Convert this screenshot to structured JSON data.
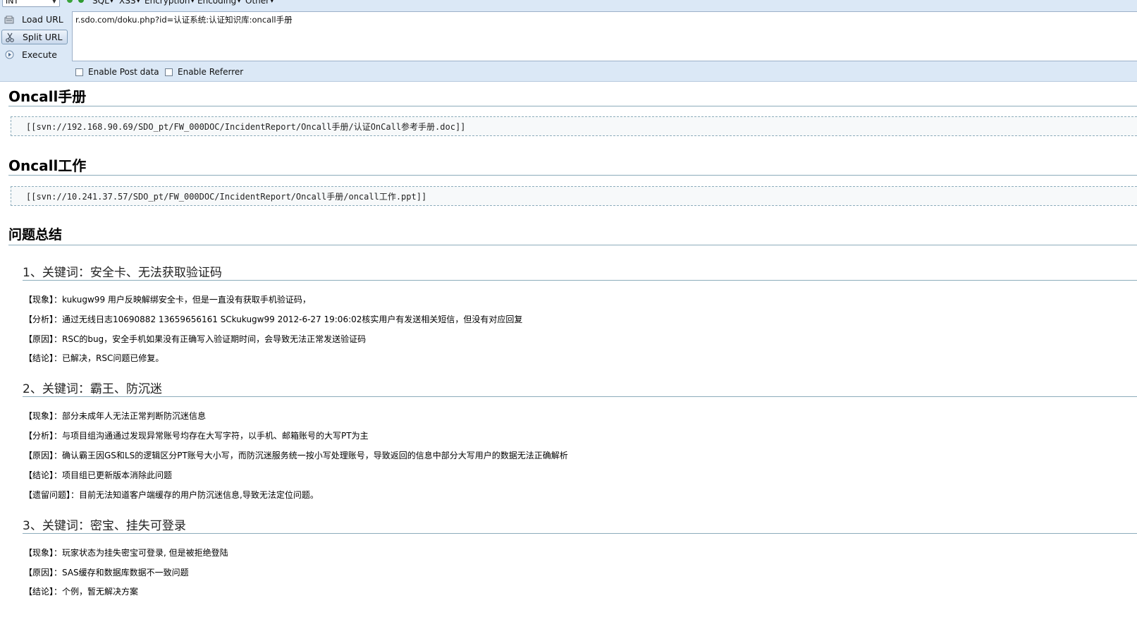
{
  "toolbar": {
    "select_value": "INT",
    "menus": [
      "SQL",
      "XSS",
      "Encryption",
      "Encoding",
      "Other"
    ],
    "load_url": "Load URL",
    "split_url": "Split URL",
    "execute": "Execute",
    "url_value": "r.sdo.com/doku.php?id=认证系统:认证知识库:oncall手册",
    "enable_post": "Enable Post data",
    "enable_referrer": "Enable Referrer"
  },
  "doc": {
    "section1": {
      "title": "Oncall手册",
      "code": "[[svn://192.168.90.69/SDO_pt/FW_000DOC/IncidentReport/Oncall手册/认证OnCall参考手册.doc]]"
    },
    "section2": {
      "title": "Oncall工作",
      "code": "[[svn://10.241.37.57/SDO_pt/FW_000DOC/IncidentReport/Oncall手册/oncall工作.ppt]]"
    },
    "section3": {
      "title": "问题总结"
    },
    "issue1": {
      "title": "1、关键词：安全卡、无法获取验证码",
      "lines": [
        "【现象】：kukugw99 用户反映解绑安全卡，但是一直没有获取手机验证码，",
        "【分析】：通过无线日志10690882 13659656161 SCkukugw99 2012-6-27 19:06:02核实用户有发送相关短信，但没有对应回复",
        "【原因】：RSC的bug，安全手机如果没有正确写入验证期时间，会导致无法正常发送验证码",
        "【结论】：已解决，RSC问题已修复。"
      ]
    },
    "issue2": {
      "title": "2、关键词：霸王、防沉迷",
      "lines": [
        "【现象】：部分未成年人无法正常判断防沉迷信息",
        "【分析】：与项目组沟通通过发现异常账号均存在大写字符，以手机、邮箱账号的大写PT为主",
        "【原因】：确认霸王因GS和LS的逻辑区分PT账号大小写，而防沉迷服务统一按小写处理账号，导致返回的信息中部分大写用户的数据无法正确解析",
        "【结论】：项目组已更新版本消除此问题",
        "【遗留问题】：目前无法知道客户端缓存的用户防沉迷信息,导致无法定位问题。"
      ]
    },
    "issue3": {
      "title": "3、关键词：密宝、挂失可登录",
      "lines": [
        "【现象】：玩家状态为挂失密宝可登录, 但是被拒绝登陆",
        "【原因】：SAS缓存和数据库数据不一致问题",
        "【结论】：个例，暂无解决方案"
      ]
    }
  }
}
